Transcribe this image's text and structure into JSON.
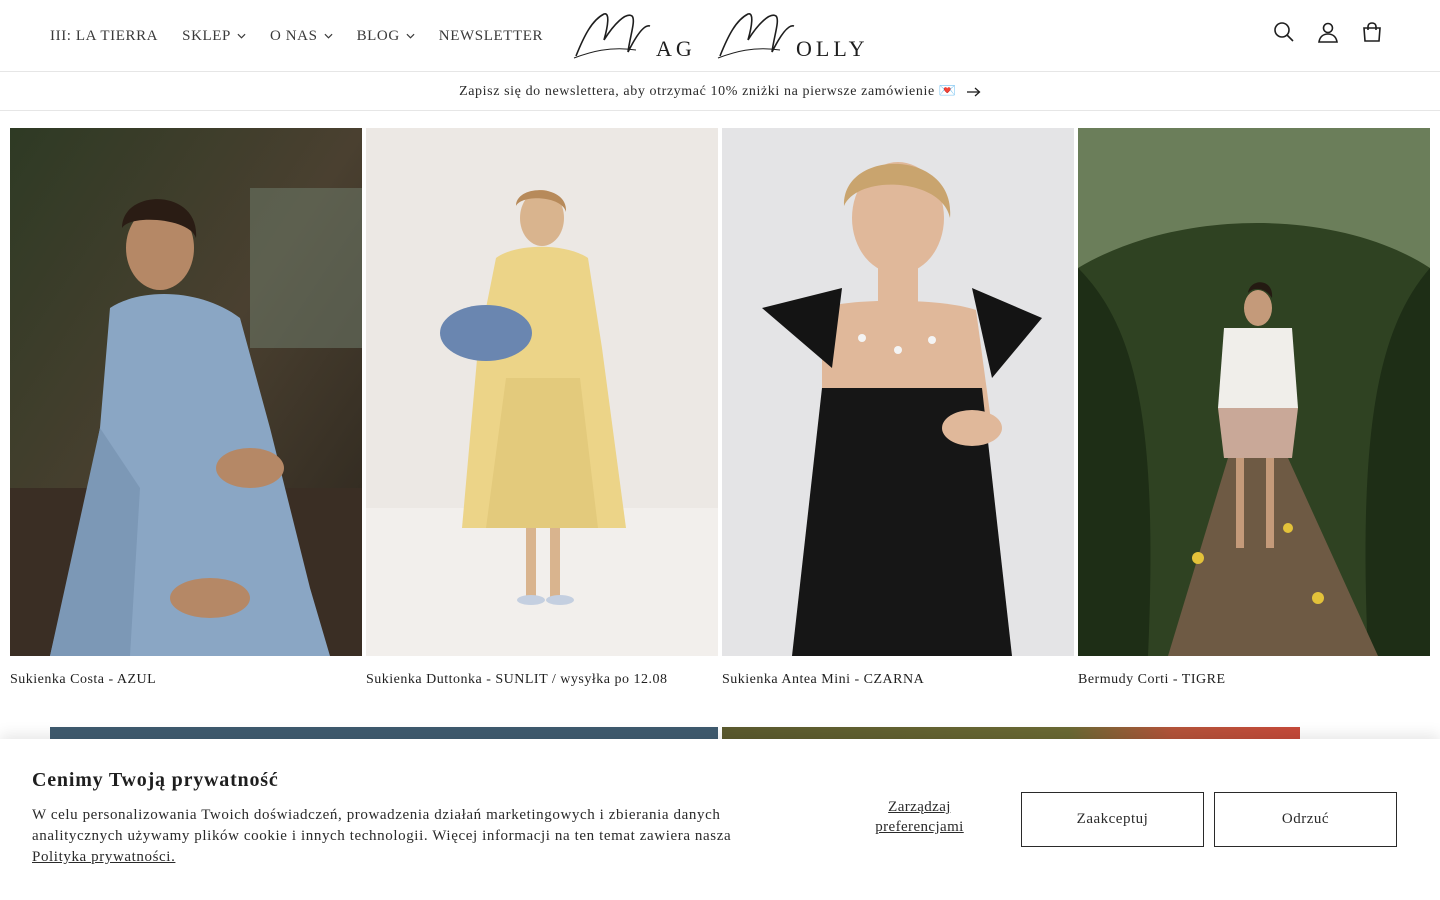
{
  "header": {
    "nav": [
      {
        "label": "III: LA TIERRA",
        "dropdown": false
      },
      {
        "label": "SKLEP",
        "dropdown": true
      },
      {
        "label": "O NAS",
        "dropdown": true
      },
      {
        "label": "BLOG",
        "dropdown": true
      },
      {
        "label": "NEWSLETTER",
        "dropdown": false
      }
    ],
    "logo_text": "Mag Molly",
    "icons": [
      "search-icon",
      "account-icon",
      "cart-icon"
    ]
  },
  "announcement": {
    "text": "Zapisz się do newslettera, aby otrzymać 10% zniżki na pierwsze zamówienie 💌"
  },
  "products": [
    {
      "title": "Sukienka Costa - AZUL"
    },
    {
      "title": "Sukienka Duttonka - SUNLIT / wysyłka po 12.08"
    },
    {
      "title": "Sukienka Antea Mini - CZARNA"
    },
    {
      "title": "Bermudy Corti - TIGRE"
    }
  ],
  "cookie": {
    "title": "Cenimy Twoją prywatność",
    "text": "W celu personalizowania Twoich doświadczeń, prowadzenia działań marketingowych i zbierania danych analitycznych używamy plików cookie i innych technologii. Więcej informacji na ten temat zawiera nasza",
    "policy_link": "Polityka prywatności.",
    "manage_label": "Zarządzaj preferencjami",
    "accept_label": "Zaakceptuj",
    "reject_label": "Odrzuć"
  },
  "colors": {
    "text": "#1e1e1e",
    "border": "#e6e6e6",
    "background": "#ffffff"
  }
}
